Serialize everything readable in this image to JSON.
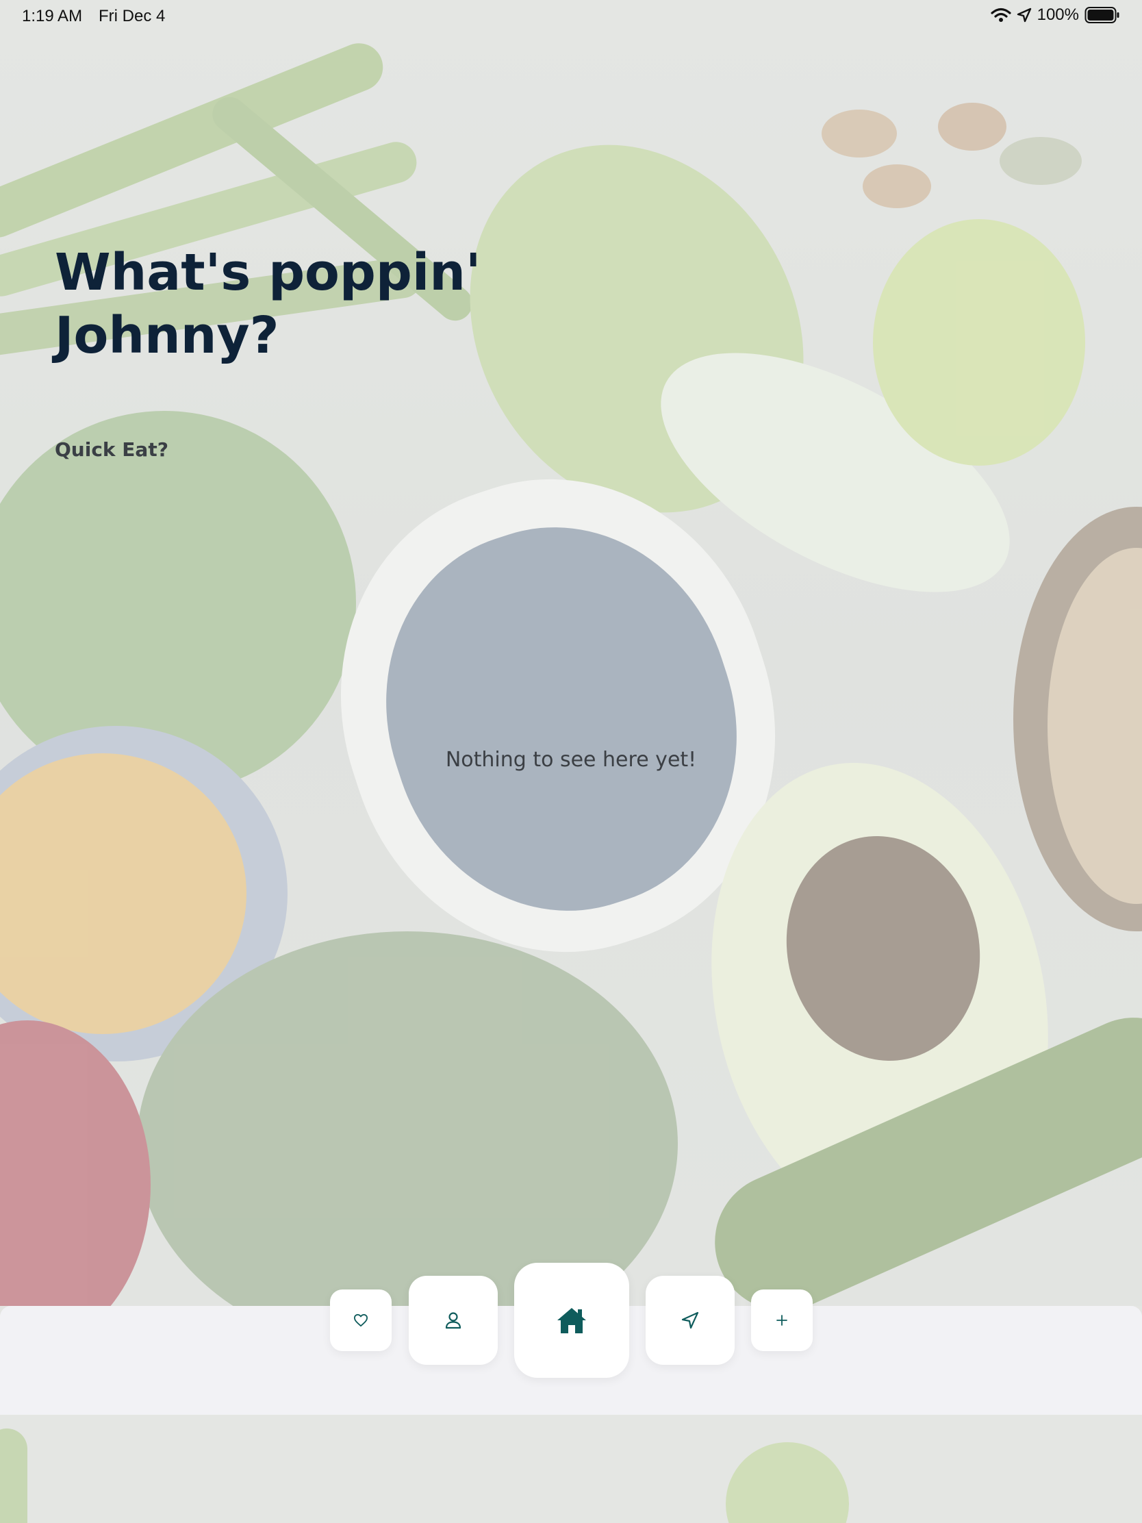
{
  "status_bar": {
    "time": "1:19 AM",
    "date": "Fri Dec 4",
    "battery": "100%",
    "icons": [
      "wifi-icon",
      "location-arrow-icon",
      "battery-icon"
    ]
  },
  "greeting": {
    "line1": "What's poppin'",
    "line2": "Johnny?"
  },
  "section_title": "Quick Eat?",
  "empty_state": "Nothing to see here yet!",
  "tab_bar": {
    "items": [
      {
        "icon": "heart-icon",
        "selected": false
      },
      {
        "icon": "user-icon",
        "selected": false
      },
      {
        "icon": "home-icon",
        "selected": true
      },
      {
        "icon": "navigation-arrow-icon",
        "selected": false
      },
      {
        "icon": "plus-icon",
        "selected": false
      }
    ]
  },
  "colors": {
    "headline": "#0e2238",
    "accent": "#0f5c5c",
    "tab_bar_bg": "#f2f2f5",
    "button_bg": "#ffffff"
  }
}
